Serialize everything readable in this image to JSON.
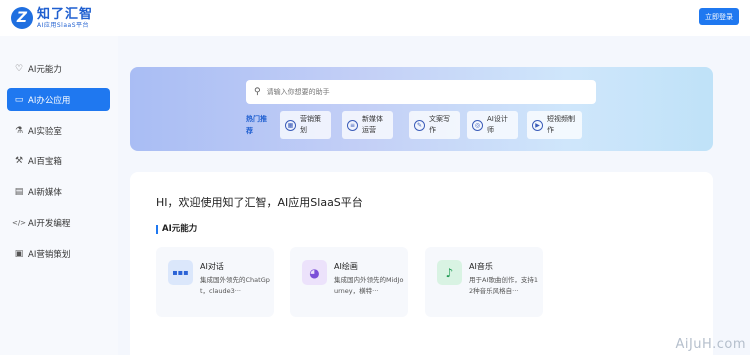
{
  "header": {
    "logo_mark": "Z",
    "logo_title": "知了汇智",
    "logo_subtitle": "AI应用SlaaS平台",
    "login_label": "立即登录"
  },
  "sidebar": {
    "items": [
      {
        "label": "AI元能力",
        "icon": "lightbulb-icon",
        "glyph": "♡",
        "active": false
      },
      {
        "label": "AI办公应用",
        "icon": "office-icon",
        "glyph": "▭",
        "active": true
      },
      {
        "label": "AI实验室",
        "icon": "flask-icon",
        "glyph": "⚗",
        "active": false
      },
      {
        "label": "AI百宝箱",
        "icon": "wrench-icon",
        "glyph": "⚒",
        "active": false
      },
      {
        "label": "AI新媒体",
        "icon": "media-icon",
        "glyph": "▤",
        "active": false
      },
      {
        "label": "AI开发编程",
        "icon": "code-icon",
        "glyph": "</>",
        "active": false
      },
      {
        "label": "AI营销策划",
        "icon": "marketing-icon",
        "glyph": "▣",
        "active": false
      }
    ]
  },
  "banner": {
    "search_placeholder": "请输入你想要的助手",
    "hot_label": "热门推荐",
    "hot_items": [
      {
        "label": "营销策划",
        "icon": "marketing-icon",
        "glyph": "▦"
      },
      {
        "label": "新媒体运营",
        "icon": "media-icon",
        "glyph": "≡"
      },
      {
        "label": "文案写作",
        "icon": "pen-icon",
        "glyph": "✎"
      },
      {
        "label": "AI设计师",
        "icon": "design-icon",
        "glyph": "◎"
      },
      {
        "label": "短视频制作",
        "icon": "video-icon",
        "glyph": "▶"
      }
    ]
  },
  "main": {
    "welcome": "HI，欢迎使用知了汇智，AI应用SlaaS平台",
    "section_title": "AI元能力",
    "cards": [
      {
        "title": "AI对话",
        "desc": "集成国外领先的ChatGpt，claude3···",
        "icon": "chat-icon",
        "glyph": "▪▪▪",
        "icon_bg": "#dbe7fb",
        "icon_color": "#2a62d6"
      },
      {
        "title": "AI绘画",
        "desc": "集成国内外领先的MidJourney，横特···",
        "icon": "palette-icon",
        "glyph": "◕",
        "icon_bg": "#ece2fb",
        "icon_color": "#7b4fd8"
      },
      {
        "title": "AI音乐",
        "desc": "用于AI歌曲创作，支持12种音乐风格自···",
        "icon": "music-icon",
        "glyph": "♪",
        "icon_bg": "#d9f3e3",
        "icon_color": "#1f9a52"
      }
    ]
  },
  "watermark": "AiJuH.com"
}
